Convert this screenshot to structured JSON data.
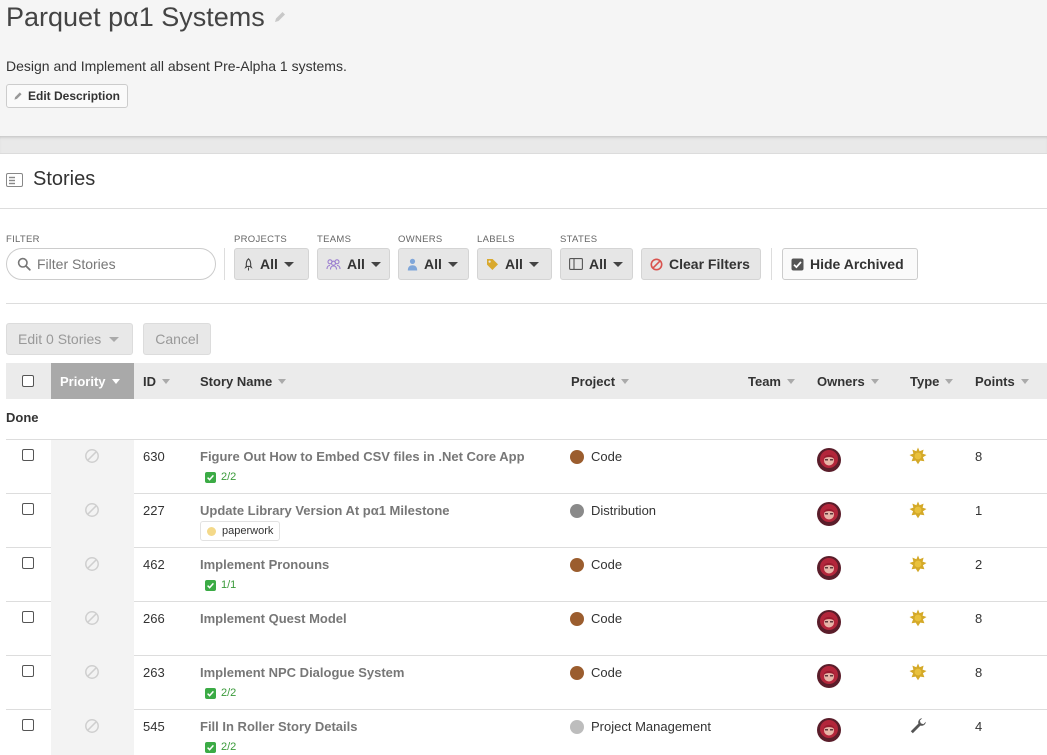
{
  "epic": {
    "title": "Parquet pα1 Systems",
    "description": "Design and Implement all absent Pre-Alpha 1 systems.",
    "edit_description_label": "Edit Description"
  },
  "stories_section": {
    "title": "Stories"
  },
  "filters": {
    "filter_label": "FILTER",
    "search_placeholder": "Filter Stories",
    "projects": {
      "label": "PROJECTS",
      "value": "All"
    },
    "teams": {
      "label": "TEAMS",
      "value": "All"
    },
    "owners": {
      "label": "OWNERS",
      "value": "All"
    },
    "labels": {
      "label": "LABELS",
      "value": "All"
    },
    "states": {
      "label": "STATES",
      "value": "All"
    },
    "clear_filters_label": "Clear Filters",
    "hide_archived_label": "Hide Archived"
  },
  "actions": {
    "edit_stories_label": "Edit 0 Stories",
    "cancel_label": "Cancel"
  },
  "table": {
    "columns": {
      "priority": "Priority",
      "id": "ID",
      "story_name": "Story Name",
      "project": "Project",
      "team": "Team",
      "owners": "Owners",
      "type": "Type",
      "points": "Points"
    },
    "group": "Done",
    "rows": [
      {
        "id": "630",
        "name": "Figure Out How to Embed CSV files in .Net Core App",
        "tasks": "2/2",
        "label": "",
        "project": "Code",
        "project_color": "#9b5d2e",
        "type": "feature",
        "points": "8"
      },
      {
        "id": "227",
        "name": "Update Library Version At pα1 Milestone",
        "tasks": "",
        "label": "paperwork",
        "project": "Distribution",
        "project_color": "#8a8a8a",
        "type": "feature",
        "points": "1"
      },
      {
        "id": "462",
        "name": "Implement Pronouns",
        "tasks": "1/1",
        "label": "",
        "project": "Code",
        "project_color": "#9b5d2e",
        "type": "feature",
        "points": "2"
      },
      {
        "id": "266",
        "name": "Implement Quest Model",
        "tasks": "",
        "label": "",
        "project": "Code",
        "project_color": "#9b5d2e",
        "type": "feature",
        "points": "8"
      },
      {
        "id": "263",
        "name": "Implement NPC Dialogue System",
        "tasks": "2/2",
        "label": "",
        "project": "Code",
        "project_color": "#9b5d2e",
        "type": "feature",
        "points": "8"
      },
      {
        "id": "545",
        "name": "Fill In Roller Story Details",
        "tasks": "2/2",
        "label": "",
        "project": "Project Management",
        "project_color": "#bdbdbd",
        "type": "chore",
        "points": "4"
      }
    ]
  }
}
